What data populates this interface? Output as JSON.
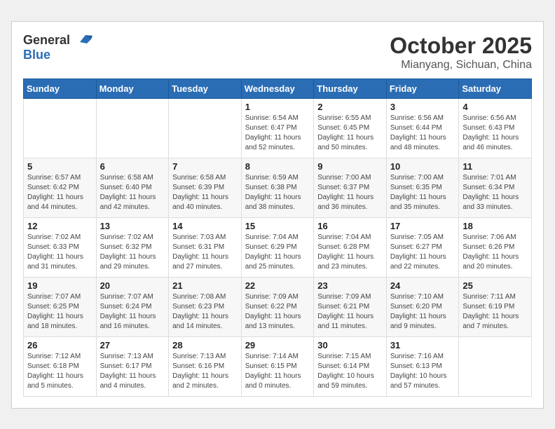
{
  "header": {
    "logo_general": "General",
    "logo_blue": "Blue",
    "month_title": "October 2025",
    "location": "Mianyang, Sichuan, China"
  },
  "weekdays": [
    "Sunday",
    "Monday",
    "Tuesday",
    "Wednesday",
    "Thursday",
    "Friday",
    "Saturday"
  ],
  "weeks": [
    [
      {
        "day": "",
        "info": ""
      },
      {
        "day": "",
        "info": ""
      },
      {
        "day": "",
        "info": ""
      },
      {
        "day": "1",
        "info": "Sunrise: 6:54 AM\nSunset: 6:47 PM\nDaylight: 11 hours\nand 52 minutes."
      },
      {
        "day": "2",
        "info": "Sunrise: 6:55 AM\nSunset: 6:45 PM\nDaylight: 11 hours\nand 50 minutes."
      },
      {
        "day": "3",
        "info": "Sunrise: 6:56 AM\nSunset: 6:44 PM\nDaylight: 11 hours\nand 48 minutes."
      },
      {
        "day": "4",
        "info": "Sunrise: 6:56 AM\nSunset: 6:43 PM\nDaylight: 11 hours\nand 46 minutes."
      }
    ],
    [
      {
        "day": "5",
        "info": "Sunrise: 6:57 AM\nSunset: 6:42 PM\nDaylight: 11 hours\nand 44 minutes."
      },
      {
        "day": "6",
        "info": "Sunrise: 6:58 AM\nSunset: 6:40 PM\nDaylight: 11 hours\nand 42 minutes."
      },
      {
        "day": "7",
        "info": "Sunrise: 6:58 AM\nSunset: 6:39 PM\nDaylight: 11 hours\nand 40 minutes."
      },
      {
        "day": "8",
        "info": "Sunrise: 6:59 AM\nSunset: 6:38 PM\nDaylight: 11 hours\nand 38 minutes."
      },
      {
        "day": "9",
        "info": "Sunrise: 7:00 AM\nSunset: 6:37 PM\nDaylight: 11 hours\nand 36 minutes."
      },
      {
        "day": "10",
        "info": "Sunrise: 7:00 AM\nSunset: 6:35 PM\nDaylight: 11 hours\nand 35 minutes."
      },
      {
        "day": "11",
        "info": "Sunrise: 7:01 AM\nSunset: 6:34 PM\nDaylight: 11 hours\nand 33 minutes."
      }
    ],
    [
      {
        "day": "12",
        "info": "Sunrise: 7:02 AM\nSunset: 6:33 PM\nDaylight: 11 hours\nand 31 minutes."
      },
      {
        "day": "13",
        "info": "Sunrise: 7:02 AM\nSunset: 6:32 PM\nDaylight: 11 hours\nand 29 minutes."
      },
      {
        "day": "14",
        "info": "Sunrise: 7:03 AM\nSunset: 6:31 PM\nDaylight: 11 hours\nand 27 minutes."
      },
      {
        "day": "15",
        "info": "Sunrise: 7:04 AM\nSunset: 6:29 PM\nDaylight: 11 hours\nand 25 minutes."
      },
      {
        "day": "16",
        "info": "Sunrise: 7:04 AM\nSunset: 6:28 PM\nDaylight: 11 hours\nand 23 minutes."
      },
      {
        "day": "17",
        "info": "Sunrise: 7:05 AM\nSunset: 6:27 PM\nDaylight: 11 hours\nand 22 minutes."
      },
      {
        "day": "18",
        "info": "Sunrise: 7:06 AM\nSunset: 6:26 PM\nDaylight: 11 hours\nand 20 minutes."
      }
    ],
    [
      {
        "day": "19",
        "info": "Sunrise: 7:07 AM\nSunset: 6:25 PM\nDaylight: 11 hours\nand 18 minutes."
      },
      {
        "day": "20",
        "info": "Sunrise: 7:07 AM\nSunset: 6:24 PM\nDaylight: 11 hours\nand 16 minutes."
      },
      {
        "day": "21",
        "info": "Sunrise: 7:08 AM\nSunset: 6:23 PM\nDaylight: 11 hours\nand 14 minutes."
      },
      {
        "day": "22",
        "info": "Sunrise: 7:09 AM\nSunset: 6:22 PM\nDaylight: 11 hours\nand 13 minutes."
      },
      {
        "day": "23",
        "info": "Sunrise: 7:09 AM\nSunset: 6:21 PM\nDaylight: 11 hours\nand 11 minutes."
      },
      {
        "day": "24",
        "info": "Sunrise: 7:10 AM\nSunset: 6:20 PM\nDaylight: 11 hours\nand 9 minutes."
      },
      {
        "day": "25",
        "info": "Sunrise: 7:11 AM\nSunset: 6:19 PM\nDaylight: 11 hours\nand 7 minutes."
      }
    ],
    [
      {
        "day": "26",
        "info": "Sunrise: 7:12 AM\nSunset: 6:18 PM\nDaylight: 11 hours\nand 5 minutes."
      },
      {
        "day": "27",
        "info": "Sunrise: 7:13 AM\nSunset: 6:17 PM\nDaylight: 11 hours\nand 4 minutes."
      },
      {
        "day": "28",
        "info": "Sunrise: 7:13 AM\nSunset: 6:16 PM\nDaylight: 11 hours\nand 2 minutes."
      },
      {
        "day": "29",
        "info": "Sunrise: 7:14 AM\nSunset: 6:15 PM\nDaylight: 11 hours\nand 0 minutes."
      },
      {
        "day": "30",
        "info": "Sunrise: 7:15 AM\nSunset: 6:14 PM\nDaylight: 10 hours\nand 59 minutes."
      },
      {
        "day": "31",
        "info": "Sunrise: 7:16 AM\nSunset: 6:13 PM\nDaylight: 10 hours\nand 57 minutes."
      },
      {
        "day": "",
        "info": ""
      }
    ]
  ]
}
